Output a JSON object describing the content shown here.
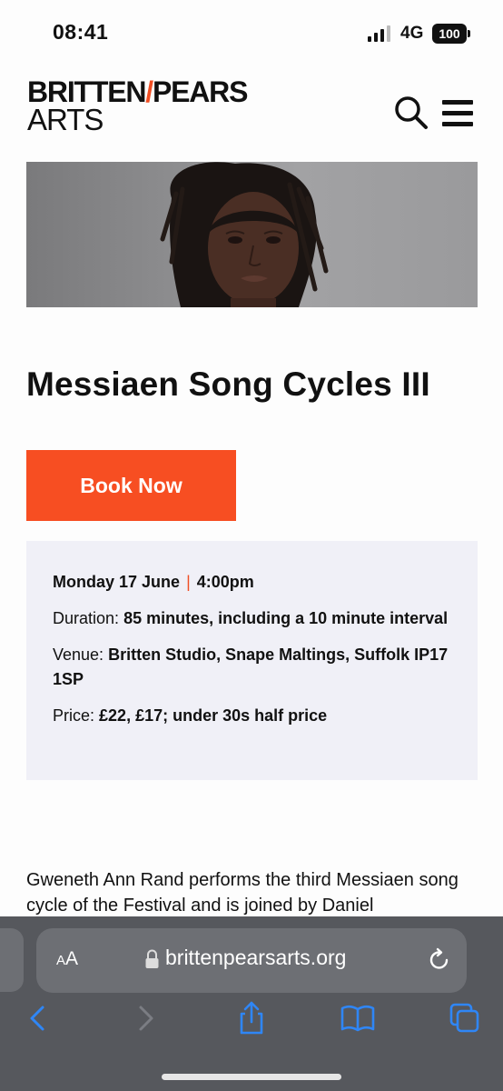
{
  "status_bar": {
    "time": "08:41",
    "network": "4G",
    "battery": "100"
  },
  "header": {
    "logo_part1": "BRITTEN",
    "logo_part2": "PEARS",
    "logo_line2": "ARTS",
    "accent_color": "#f04e23"
  },
  "event": {
    "title": "Messiaen Song Cycles III",
    "book_label": "Book Now",
    "book_color": "#f74e22",
    "date": "Monday 17 June",
    "separator": "|",
    "time": "4:00pm",
    "duration_label": "Duration:",
    "duration_value": "85 minutes, including a 10 minute interval",
    "venue_label": "Venue:",
    "venue_value": "Britten Studio, Snape Maltings, Suffolk IP17 1SP",
    "price_label": "Price:",
    "price_value": "£22, £17; under 30s half price",
    "description": "Gweneth Ann Rand performs the third Messiaen song cycle of the Festival and is joined by Daniel"
  },
  "browser": {
    "text_size_small": "A",
    "text_size_large": "A",
    "url": "brittenpearsarts.org",
    "icons": [
      "back-icon",
      "forward-icon",
      "share-icon",
      "bookmarks-icon",
      "tabs-icon",
      "lock-icon",
      "reload-icon"
    ]
  }
}
